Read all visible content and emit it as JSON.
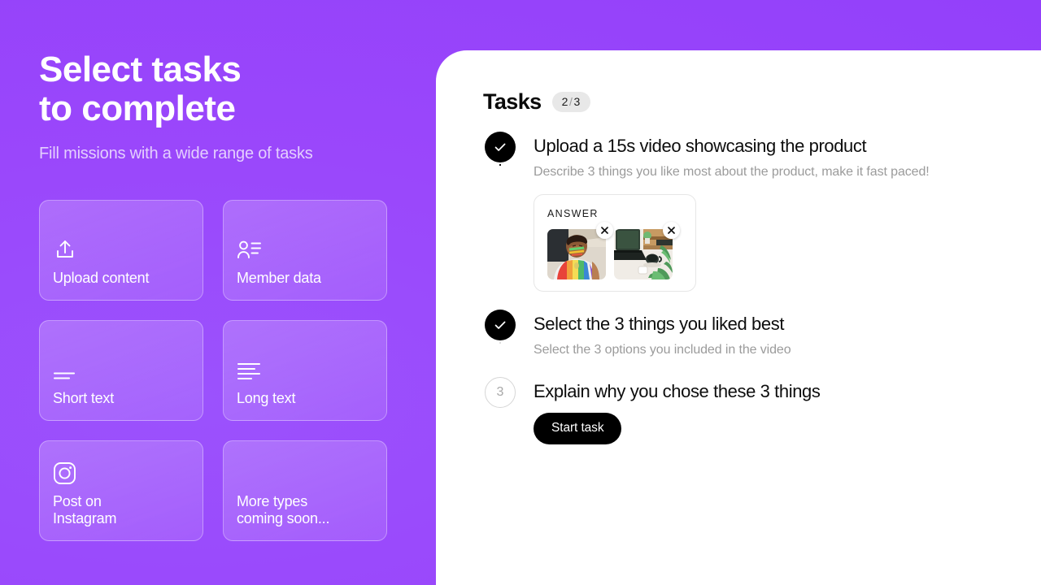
{
  "theme": {
    "brand_purple": "#9a47fb",
    "panel_bg": "#ffffff",
    "accent_black": "#000000",
    "muted_text": "#9b9b9b",
    "subhead_text": "#e4cffe",
    "pending_gray": "#d6d6d6",
    "badge_bg": "#e8e8e8"
  },
  "promo": {
    "headline": "Select tasks\nto complete",
    "subhead": "Fill missions with a wide range of tasks",
    "task_types": [
      {
        "label": "Upload content",
        "icon": "upload-icon"
      },
      {
        "label": "Member data",
        "icon": "member-data-icon"
      },
      {
        "label": "Short text",
        "icon": "short-text-icon"
      },
      {
        "label": "Long text",
        "icon": "long-text-icon"
      },
      {
        "label": "Post on\nInstagram",
        "icon": "instagram-icon"
      },
      {
        "label": "More types\ncoming soon...",
        "icon": "none"
      }
    ]
  },
  "panel": {
    "title": "Tasks",
    "counter": {
      "completed": "2",
      "separator": "/",
      "total": "3",
      "text": "2 / 3"
    },
    "tasks": [
      {
        "number": "1",
        "state": "done",
        "status_icon": "check-icon",
        "title": "Upload a 15s video showcasing the product",
        "description": "Describe 3 things you like most about the product, make it fast paced!",
        "answer": {
          "label": "ANSWER",
          "thumbnails": [
            {
              "alt": "selfie-portrait-thumbnail",
              "remove_icon": "close-icon"
            },
            {
              "alt": "desk-laptop-thumbnail",
              "remove_icon": "close-icon"
            }
          ]
        }
      },
      {
        "number": "2",
        "state": "done",
        "status_icon": "check-icon",
        "title": "Select the 3 things you liked best",
        "description": "Select the 3 options you included in the video"
      },
      {
        "number": "3",
        "state": "pending",
        "status_icon": "step-number",
        "title": "Explain why you chose these 3 things",
        "action_label": "Start task"
      }
    ]
  }
}
